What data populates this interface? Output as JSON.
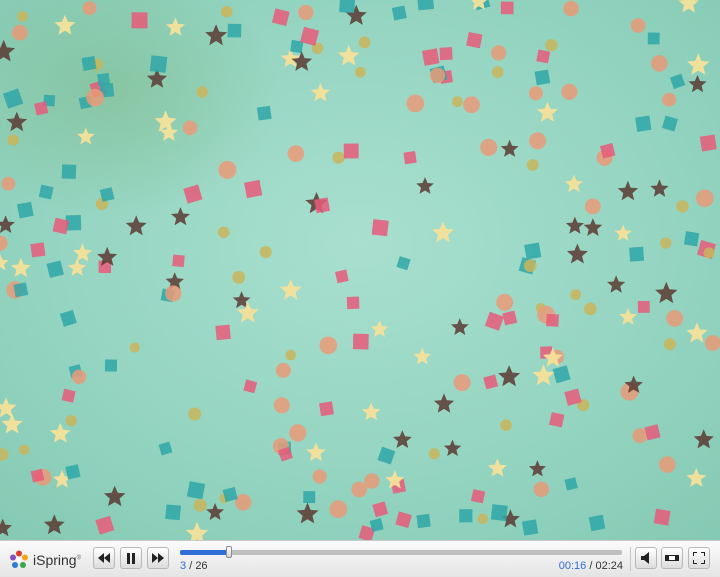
{
  "player": {
    "brand": "iSpring",
    "brand_mark": "®",
    "slide_current": "3",
    "slide_separator": "/",
    "slide_total": "26",
    "time_elapsed": "00:16",
    "time_separator": "/",
    "time_total": "02:24",
    "progress_fraction": 0.11
  },
  "controls": {
    "prev": "rewind-icon",
    "pause": "pause-icon",
    "next": "fast-forward-icon",
    "volume": "volume-icon",
    "layout": "layout-icon",
    "fullscreen": "fullscreen-icon"
  },
  "slide": {
    "background_colors": [
      "#8fd3c0",
      "#a7dccc",
      "#7bc3a4"
    ],
    "confetti_colors": [
      "#e85a7a",
      "#2fa7a8",
      "#f4e09a",
      "#5a3a33",
      "#e99a78",
      "#c9b55a"
    ]
  }
}
